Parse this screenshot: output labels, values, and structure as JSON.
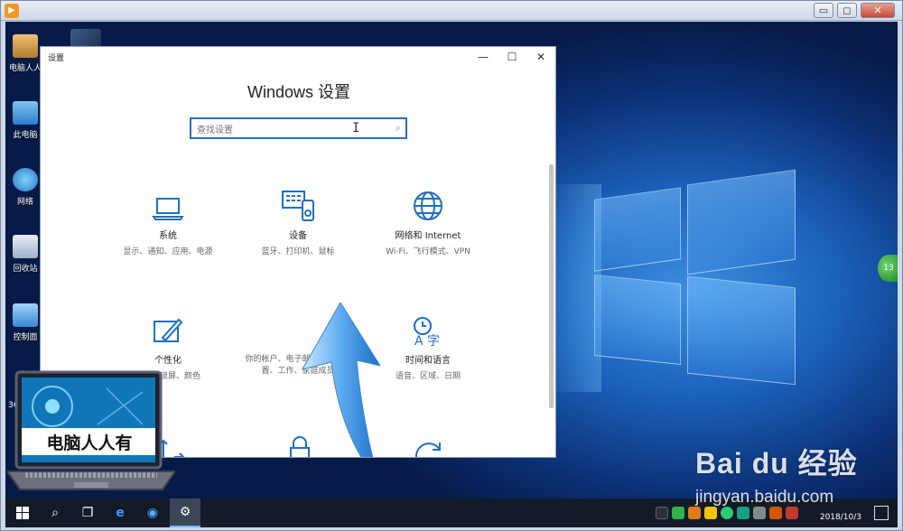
{
  "player": {
    "controls": [
      "▭",
      "◻",
      "✕"
    ]
  },
  "desktop": {
    "icons": [
      {
        "label": "电脑人人",
        "name": "desktop-icon-user"
      },
      {
        "label": "此电脑",
        "name": "desktop-icon-this-pc"
      },
      {
        "label": "网络",
        "name": "desktop-icon-network"
      },
      {
        "label": "回收站",
        "name": "desktop-icon-recycle-bin"
      },
      {
        "label": "控制面",
        "name": "desktop-icon-control-panel"
      }
    ],
    "side_number": "36",
    "green_ball_text": "13"
  },
  "settings": {
    "window_title": "设置",
    "heading": "Windows 设置",
    "search_placeholder": "查找设置",
    "tiles": [
      {
        "name": "系统",
        "desc": "显示、通知、应用、电源",
        "icon": "laptop-icon"
      },
      {
        "name": "设备",
        "desc": "蓝牙、打印机、鼠标",
        "icon": "devices-icon"
      },
      {
        "name": "网络和 Internet",
        "desc": "Wi-Fi、飞行模式、VPN",
        "icon": "globe-icon"
      },
      {
        "name": "个性化",
        "desc": "背景、锁屏、颜色",
        "icon": "personalization-icon"
      },
      {
        "name": "",
        "desc": "你的帐户、电子邮件、同步设置、工作、家庭成员",
        "icon": "accounts-icon"
      },
      {
        "name": "时间和语言",
        "desc": "语音、区域、日期",
        "icon": "time-language-icon"
      }
    ]
  },
  "overlay": {
    "laptop_caption": "电脑人人有"
  },
  "taskbar": {
    "items": [
      "start",
      "search",
      "task-view",
      "edge",
      "quicktime",
      "settings"
    ],
    "date": "2018/10/3"
  },
  "watermark": {
    "main": "Bai du 经验",
    "url": "jingyan.baidu.com"
  },
  "colors": {
    "accent": "#2a6ebd",
    "icon_blue": "#1e6fc0",
    "taskbar": "#121a27"
  }
}
